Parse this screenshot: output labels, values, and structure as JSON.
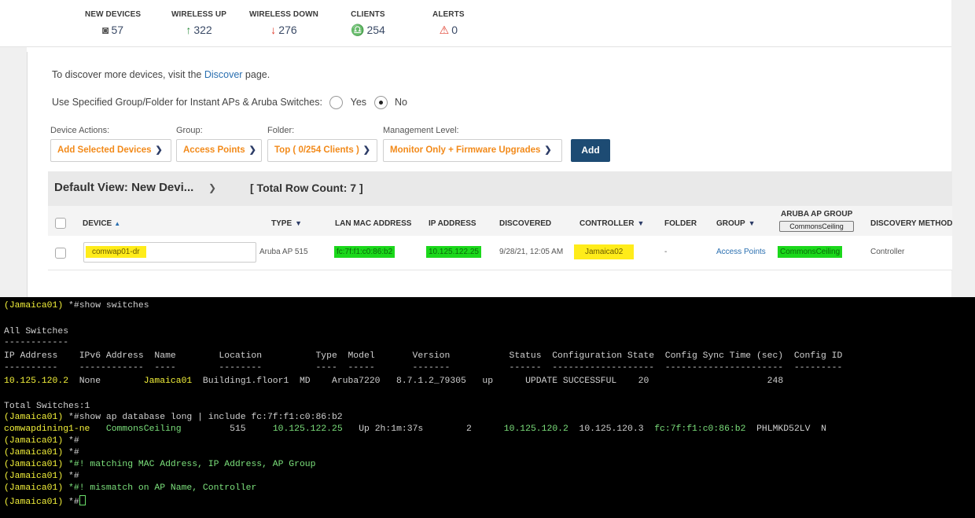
{
  "stats": [
    {
      "label": "NEW DEVICES",
      "icon": "device-icon",
      "glyph": "◙",
      "value": "57"
    },
    {
      "label": "WIRELESS UP",
      "icon": "arrow-up-icon",
      "glyph": "↑",
      "value": "322"
    },
    {
      "label": "WIRELESS DOWN",
      "icon": "arrow-down-icon",
      "glyph": "↓",
      "value": "276"
    },
    {
      "label": "CLIENTS",
      "icon": "client-icon",
      "glyph": "♎",
      "value": "254"
    },
    {
      "label": "ALERTS",
      "icon": "alert-icon",
      "glyph": "⚠",
      "value": "0"
    }
  ],
  "discover": {
    "prefix": "To discover more devices, visit the ",
    "link": "Discover",
    "suffix": " page."
  },
  "specified_group": {
    "label": "Use Specified Group/Folder for Instant APs & Aruba Switches:",
    "yes": "Yes",
    "no": "No",
    "selected": "No"
  },
  "actions": {
    "device_actions_label": "Device Actions:",
    "device_actions_value": "Add Selected Devices",
    "group_label": "Group:",
    "group_value": "Access Points",
    "folder_label": "Folder:",
    "folder_value": "Top ( 0/254 Clients )",
    "management_label": "Management Level:",
    "management_value": "Monitor Only + Firmware Upgrades",
    "add_label": "Add"
  },
  "table": {
    "view_name": "Default View: New Devi...",
    "row_count": "[ Total Row Count: 7 ]",
    "headers": {
      "device": "DEVICE",
      "type": "TYPE",
      "lan_mac": "LAN MAC ADDRESS",
      "ip": "IP ADDRESS",
      "discovered": "DISCOVERED",
      "controller": "CONTROLLER",
      "folder": "FOLDER",
      "group": "GROUP",
      "aruba_ap_group": "ARUBA AP GROUP",
      "aruba_ap_group_button": "CommonsCeiling",
      "discovery_method": "DISCOVERY METHOD"
    },
    "row": {
      "device": "comwap01-dr",
      "type": "Aruba AP 515",
      "lan_mac": "fc:7f:f1:c0:86:b2",
      "ip": "10.125.122.25",
      "discovered": "9/28/21, 12:05 AM",
      "controller": "Jamaica02",
      "folder": "-",
      "group": "Access Points",
      "aruba_ap_group": "CommonsCeiling",
      "discovery_method": "Controller"
    }
  },
  "terminal": {
    "prompt1": "(Jamaica01) ",
    "cmd1": "*#show switches",
    "heading": "All Switches",
    "heading_rule": "------------",
    "columns": "IP Address    IPv6 Address  Name        Location          Type  Model       Version           Status  Configuration State  Config Sync Time (sec)  Config ID",
    "rules": "----------    ------------  ----        --------          ----  -----       -------           ------  -------------------  ----------------------  ---------",
    "sw_ip": "10.125.120.2",
    "sw_ipv6": "  None        ",
    "sw_name": "Jamaica01",
    "sw_rest": "  Building1.floor1  MD    Aruba7220   8.7.1.2_79305   up      UPDATE SUCCESSFUL    20                      248",
    "total": "Total Switches:1",
    "cmd2": "*#show ap database long | include fc:7f:f1:c0:86:b2",
    "ap_name": "comwapdining1-ne",
    "ap_group": "CommonsCeiling",
    "ap_model": "515",
    "ap_ip": "10.125.122.25",
    "ap_status": "Up 2h:1m:37s",
    "ap_flags": "2",
    "ap_switch_ip": "10.125.120.2",
    "ap_standby_ip": "10.125.120.3",
    "ap_wired_mac": "fc:7f:f1:c0:86:b2",
    "ap_serial": "PHLMKD52LV",
    "ap_more": "N",
    "empty_prompt": "*#",
    "comment1": "*#! matching MAC Address, IP Address, AP Group",
    "comment2": "*#! mismatch on AP Name, Controller",
    "last_prompt": "*#"
  }
}
